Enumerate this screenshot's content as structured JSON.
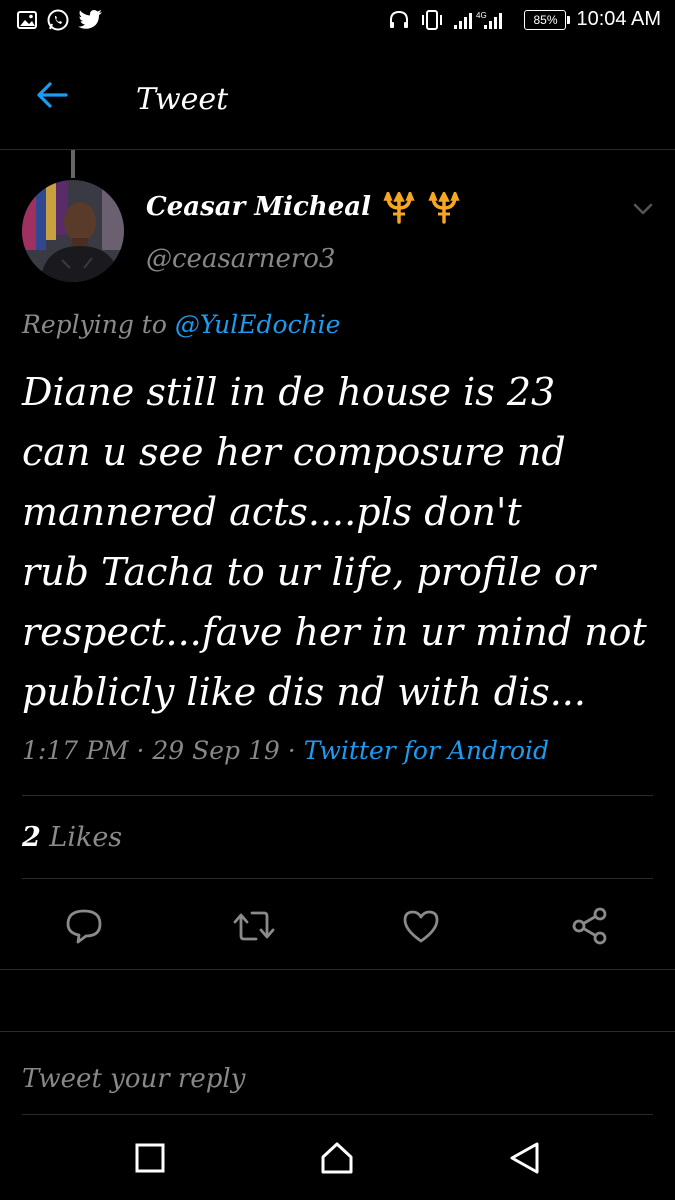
{
  "status_bar": {
    "battery": "85%",
    "time": "10:04 AM"
  },
  "header": {
    "title": "Tweet"
  },
  "tweet": {
    "author_name": "Ceasar Micheal",
    "handle": "@ceasarnero3",
    "replying_label": "Replying to",
    "replying_to": "@YulEdochie",
    "text_lines": [
      "Diane still in de house is 23",
      "can u see her composure nd",
      "mannered acts....pls don't",
      "rub Tacha to ur life, profile or",
      "respect...fave her in ur mind not",
      "publicly like dis nd with dis..."
    ],
    "time": "1:17 PM",
    "date": "29 Sep 19",
    "source": "Twitter for Android",
    "likes_count": "2",
    "likes_label": "Likes"
  },
  "reply": {
    "placeholder": "Tweet your reply"
  },
  "colors": {
    "accent": "#1d9bf0",
    "background": "#000000",
    "muted": "#888888",
    "trident": "#f5a623"
  },
  "icons": [
    "gallery-icon",
    "whatsapp-icon",
    "twitter-icon",
    "headphones-icon",
    "vibrate-icon",
    "signal-icon",
    "battery-icon",
    "back-arrow-icon",
    "trident-icon",
    "chevron-down-icon",
    "reply-icon",
    "retweet-icon",
    "like-icon",
    "share-icon",
    "recent-apps-icon",
    "home-icon",
    "back-nav-icon"
  ]
}
